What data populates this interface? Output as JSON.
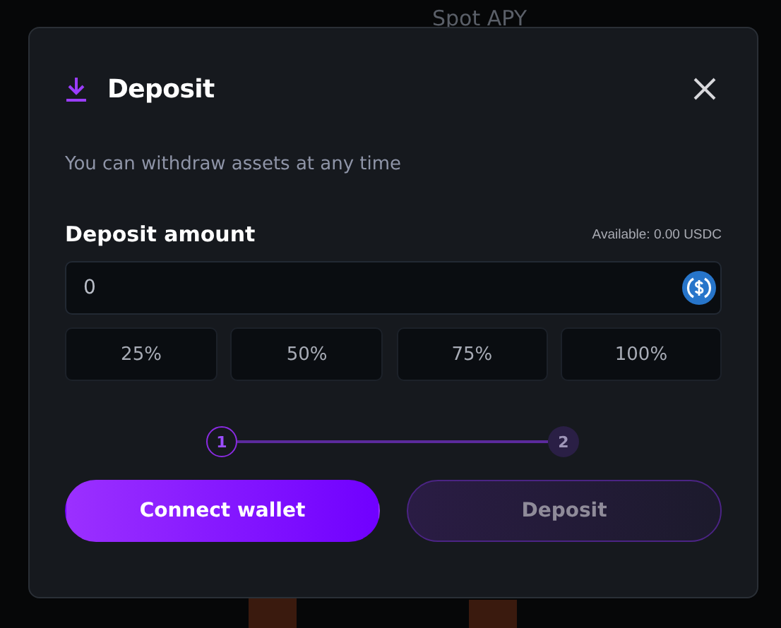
{
  "background": {
    "texts": [
      "Spot APY"
    ]
  },
  "dialog": {
    "title": "Deposit",
    "subtitle": "You can withdraw assets at any time",
    "amount_label": "Deposit amount",
    "available": "Available: 0.00 USDC",
    "amount_field": {
      "value": "0"
    },
    "percent_buttons": [
      "25%",
      "50%",
      "75%",
      "100%"
    ],
    "steps": [
      {
        "label": "1",
        "active": true
      },
      {
        "label": "2",
        "active": false
      }
    ],
    "buttons": [
      {
        "label": "Connect wallet",
        "disabled": false
      },
      {
        "label": "Deposit",
        "disabled": true
      }
    ]
  }
}
